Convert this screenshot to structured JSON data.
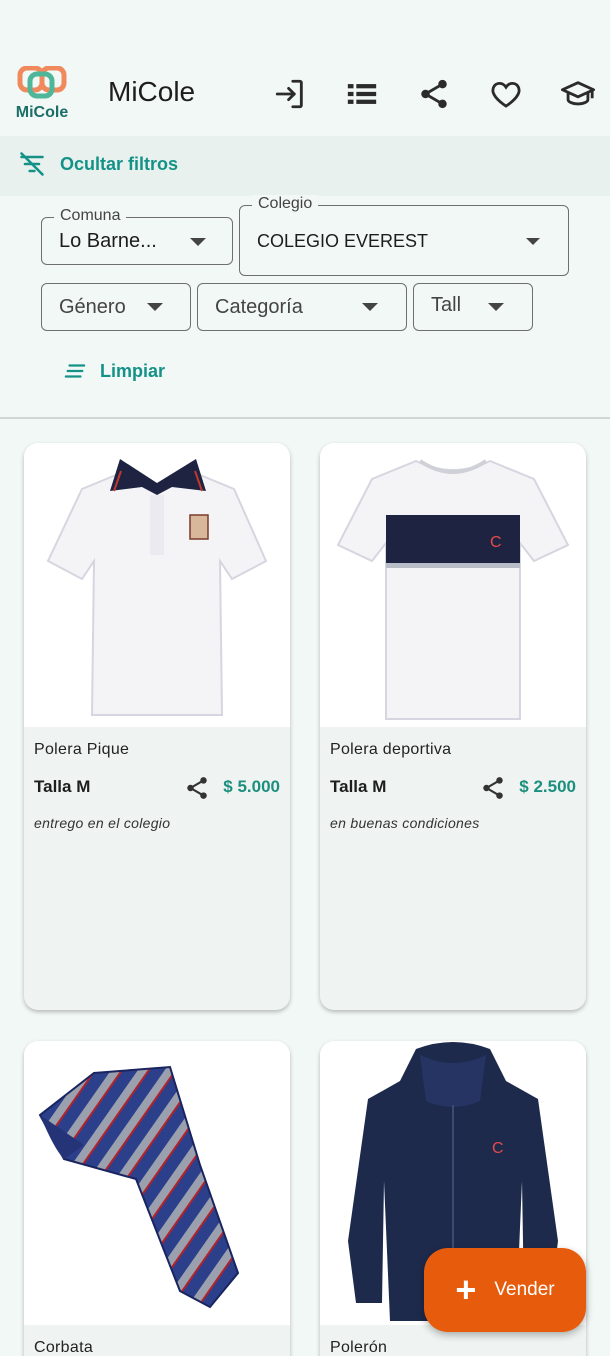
{
  "app": {
    "logo_text": "MiCole",
    "title": "MiCole",
    "actions": [
      {
        "icon": "login-icon"
      },
      {
        "icon": "list-icon"
      },
      {
        "icon": "share-icon"
      },
      {
        "icon": "heart-icon"
      },
      {
        "icon": "graduation-cap-icon"
      }
    ]
  },
  "filters": {
    "toggle_label": "Ocultar filtros",
    "comuna": {
      "label": "Comuna",
      "value": "Lo Barne..."
    },
    "colegio": {
      "label": "Colegio",
      "value": "COLEGIO EVEREST"
    },
    "genero": {
      "placeholder": "Género"
    },
    "categoria": {
      "placeholder": "Categoría"
    },
    "talla": {
      "placeholder": "Tall"
    },
    "clear_label": "Limpiar"
  },
  "products": [
    {
      "name": "Polera Pique",
      "size": "Talla M",
      "price": "$ 5.000",
      "description": "entrego en el colegio",
      "image": "polo-shirt"
    },
    {
      "name": "Polera deportiva",
      "size": "Talla M",
      "price": "$ 2.500",
      "description": "en buenas condiciones",
      "image": "sport-shirt"
    },
    {
      "name": "Corbata",
      "size": "",
      "price": "",
      "description": "",
      "image": "tie"
    },
    {
      "name": "Polerón",
      "size": "",
      "price": "",
      "description": "",
      "image": "hoodie"
    }
  ],
  "fab": {
    "label": "Vender",
    "icon": "plus-icon"
  },
  "colors": {
    "accent": "#149287",
    "price": "#1c8f7e",
    "fab": "#e65c0c",
    "background": "#f2f8f6"
  }
}
